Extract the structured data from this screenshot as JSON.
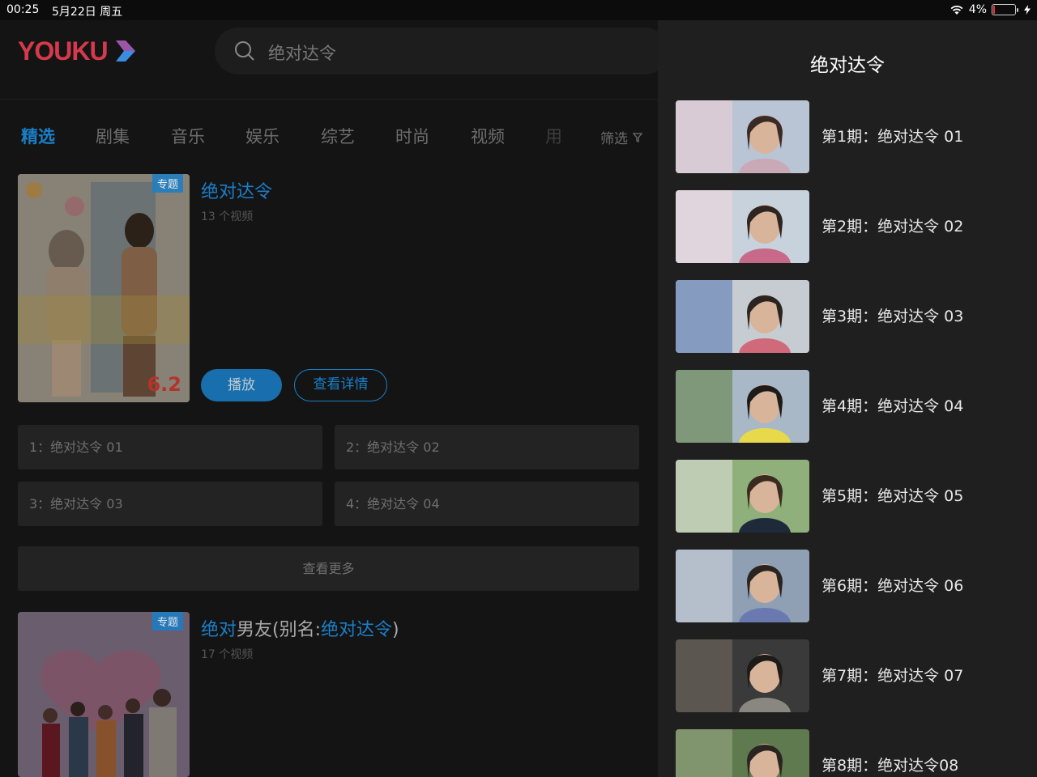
{
  "status_bar": {
    "time": "00:25",
    "date": "5月22日 周五",
    "battery": "4%",
    "battery_level": 0.04
  },
  "header": {
    "logo_text": "YOUKU",
    "search": {
      "value": "绝对达令"
    }
  },
  "tabs": [
    {
      "label": "精选",
      "active": true
    },
    {
      "label": "剧集",
      "active": false
    },
    {
      "label": "音乐",
      "active": false
    },
    {
      "label": "娱乐",
      "active": false
    },
    {
      "label": "综艺",
      "active": false
    },
    {
      "label": "时尚",
      "active": false
    },
    {
      "label": "视频",
      "active": false
    },
    {
      "label": "用",
      "active": false
    }
  ],
  "filter_label": "筛选",
  "results": [
    {
      "badge": "专题",
      "score": "6.2",
      "title": "绝对达令",
      "count": "13 个视频",
      "play_label": "播放",
      "detail_label": "查看详情",
      "episodes": [
        "1：绝对达令 01",
        "2：绝对达令 02",
        "3：绝对达令 03",
        "4：绝对达令 04"
      ],
      "more_label": "查看更多"
    },
    {
      "badge": "专题",
      "title_parts": [
        "绝对",
        "男友(别名:",
        "绝对达令",
        ")"
      ],
      "count": "17 个视频"
    }
  ],
  "panel": {
    "title": "绝对达令",
    "items": [
      "第1期：绝对达令 01",
      "第2期：绝对达令 02",
      "第3期：绝对达令 03",
      "第4期：绝对达令 04",
      "第5期：绝对达令 05",
      "第6期：绝对达令 06",
      "第7期：绝对达令 07",
      "第8期：绝对达令08"
    ]
  },
  "colors": {
    "accent": "#1a7fc8",
    "brand": "#d43a4c"
  }
}
